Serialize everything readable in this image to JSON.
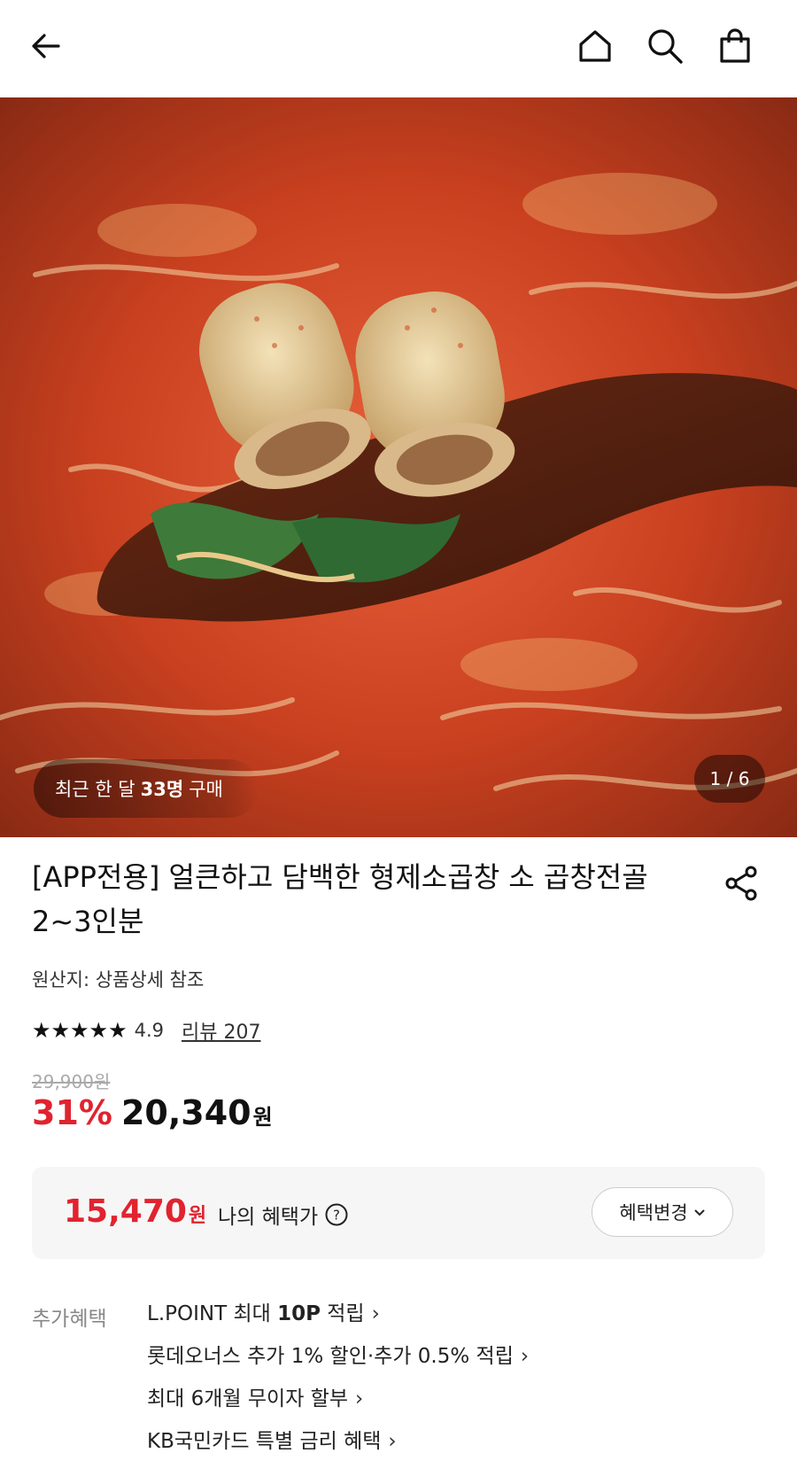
{
  "header": {
    "back_icon": "back-arrow-icon",
    "home_icon": "home-icon",
    "search_icon": "search-icon",
    "cart_icon": "shopping-bag-icon"
  },
  "hero": {
    "image_alt": "곱창전골",
    "purchase_prefix": "최근 한 달",
    "purchase_count": "33명",
    "purchase_suffix": "구매",
    "pager": "1 / 6"
  },
  "product": {
    "title": "[APP전용] 얼큰하고 담백한 형제소곱창 소 곱창전골 2~3인분",
    "origin": "원산지: 상품상세 참조",
    "stars": "★★★★★",
    "rating": "4.9",
    "reviews": "리뷰 207",
    "original_price": "29,900원",
    "discount": "31%",
    "price": "20,340",
    "price_unit": "원"
  },
  "benefit": {
    "price": "15,470",
    "price_unit": "원",
    "label": "나의 혜택가",
    "change_button": "혜택변경"
  },
  "extra": {
    "label": "추가혜택",
    "items": [
      {
        "pre": "L.POINT 최대 ",
        "bold": "10P",
        "post": " 적립"
      },
      {
        "pre": "롯데오너스 추가 1% 할인·추가 0.5% 적립",
        "bold": "",
        "post": ""
      },
      {
        "pre": "최대 6개월 무이자 할부",
        "bold": "",
        "post": ""
      },
      {
        "pre": "KB국민카드 특별 금리 혜택",
        "bold": "",
        "post": ""
      }
    ]
  },
  "colors": {
    "accent_red": "#e0232f",
    "text": "#111111",
    "muted": "#888888"
  }
}
